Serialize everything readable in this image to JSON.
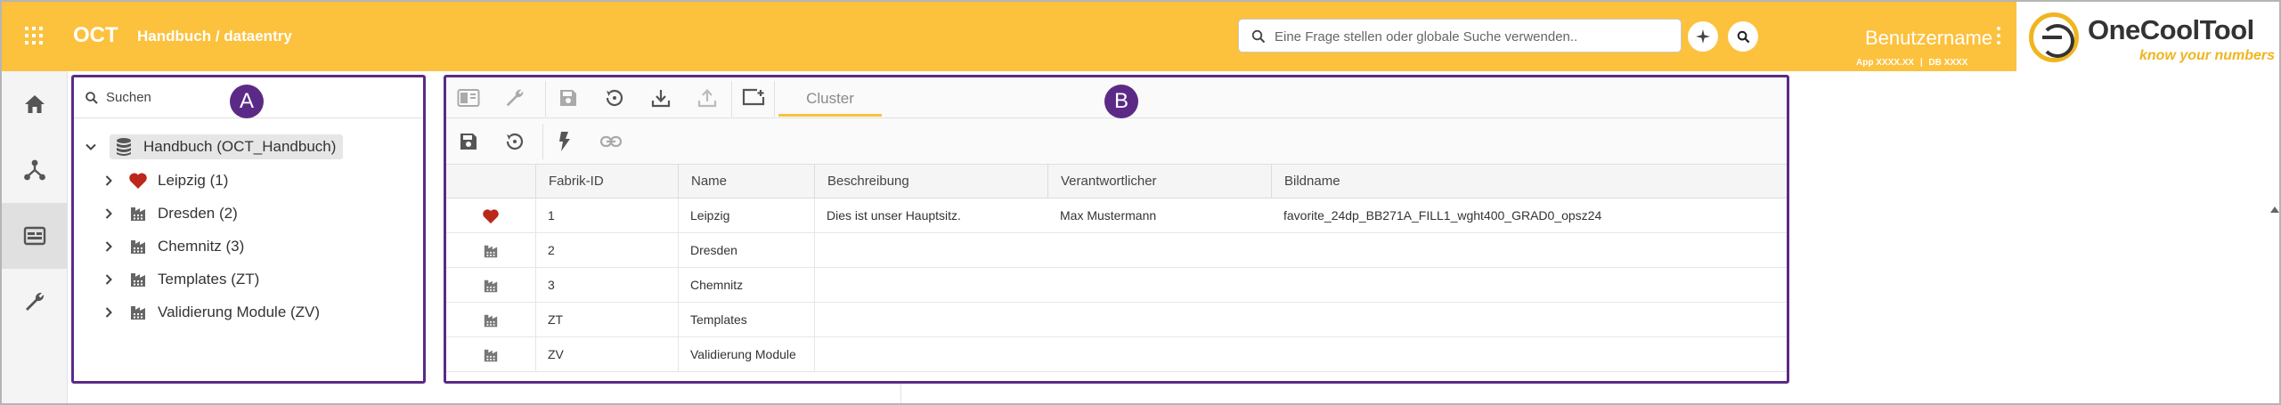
{
  "header": {
    "app_name": "OCT",
    "breadcrumb": "Handbuch / dataentry",
    "search_placeholder": "Eine Frage stellen oder globale Suche verwenden..",
    "user_name": "Benutzername",
    "app_label": "App",
    "app_value": "XXXX.XX",
    "db_label": "DB",
    "db_value": "XXXX",
    "logo_name": "OneCoolTool",
    "logo_tagline": "know your numbers"
  },
  "rail": {
    "items": [
      "home-icon",
      "hierarchy-icon",
      "dataentry-icon",
      "wrench-icon"
    ]
  },
  "tree": {
    "search_label": "Suchen",
    "badge": "A",
    "root_label": "Handbuch (OCT_Handbuch)",
    "items": [
      {
        "label": "Leipzig (1)",
        "icon": "heart-icon"
      },
      {
        "label": "Dresden (2)",
        "icon": "factory-icon"
      },
      {
        "label": "Chemnitz (3)",
        "icon": "factory-icon"
      },
      {
        "label": "Templates (ZT)",
        "icon": "factory-icon"
      },
      {
        "label": "Validierung Module (ZV)",
        "icon": "factory-icon"
      }
    ]
  },
  "grid": {
    "badge": "B",
    "tab_label": "Cluster",
    "columns": [
      "Fabrik-ID",
      "Name",
      "Beschreibung",
      "Verantwortlicher",
      "Bildname"
    ],
    "rows": [
      {
        "icon": "heart-icon",
        "id": "1",
        "name": "Leipzig",
        "desc": "Dies ist unser Hauptsitz.",
        "owner": "Max Mustermann",
        "image": "favorite_24dp_BB271A_FILL1_wght400_GRAD0_opsz24"
      },
      {
        "icon": "factory-icon",
        "id": "2",
        "name": "Dresden",
        "desc": "",
        "owner": "",
        "image": ""
      },
      {
        "icon": "factory-icon",
        "id": "3",
        "name": "Chemnitz",
        "desc": "",
        "owner": "",
        "image": ""
      },
      {
        "icon": "factory-icon",
        "id": "ZT",
        "name": "Templates",
        "desc": "",
        "owner": "",
        "image": ""
      },
      {
        "icon": "factory-icon",
        "id": "ZV",
        "name": "Validierung Module",
        "desc": "",
        "owner": "",
        "image": ""
      }
    ]
  },
  "colors": {
    "header": "#fcc13d",
    "accent_purple": "#5b2a86",
    "heart": "#bb271a"
  }
}
